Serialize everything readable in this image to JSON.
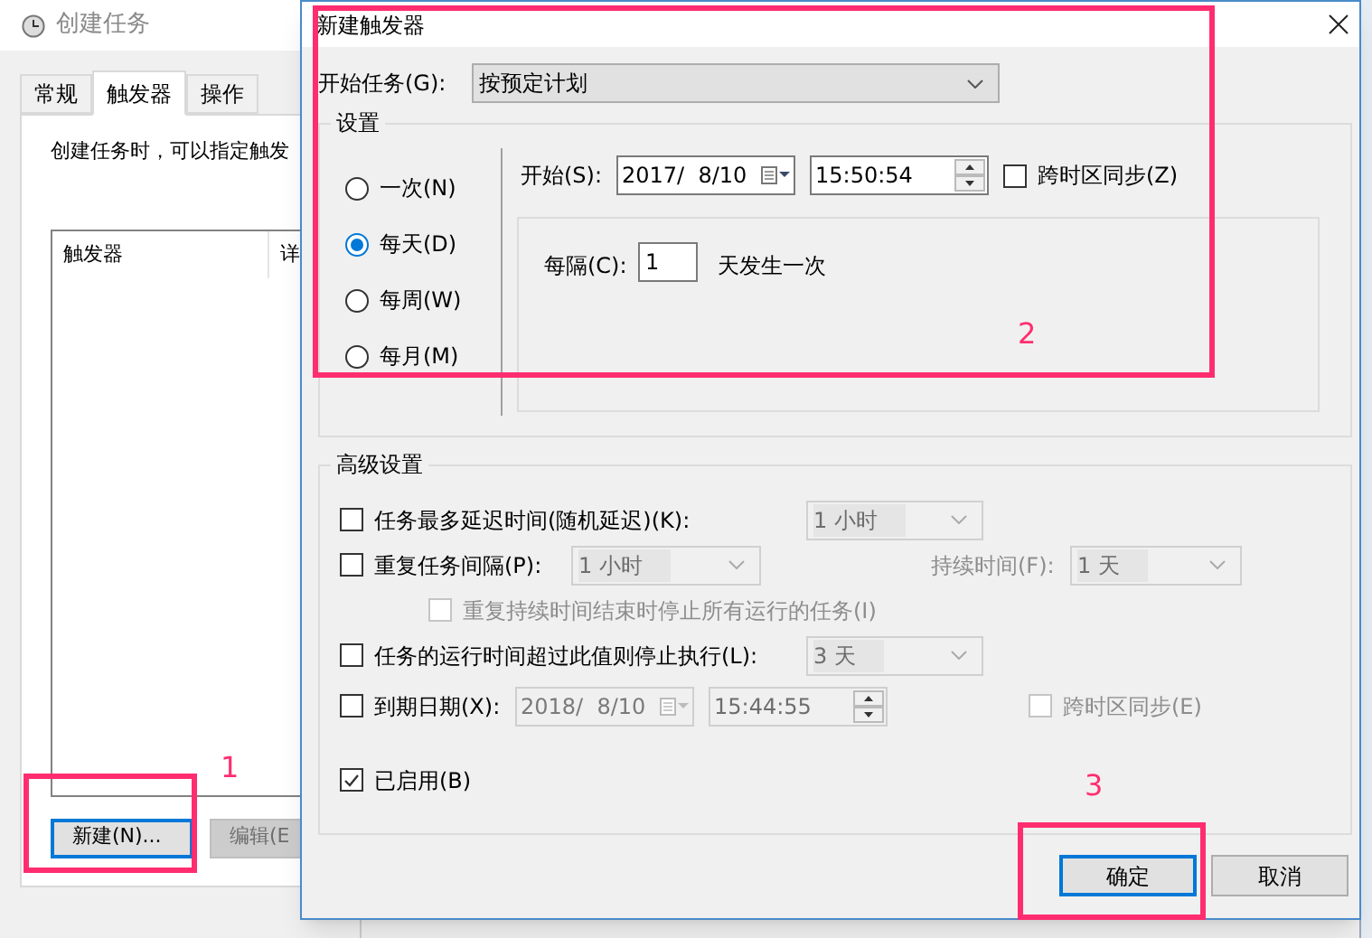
{
  "background_window": {
    "title": "创建任务",
    "tabs": [
      {
        "label": "常规",
        "selected": false
      },
      {
        "label": "触发器",
        "selected": true
      },
      {
        "label": "操作",
        "selected": false
      }
    ],
    "description": "创建任务时，可以指定触发",
    "list_columns": [
      "触发器",
      "详"
    ],
    "buttons": [
      {
        "label": "新建(N)...",
        "focused": true
      },
      {
        "label": "编辑(E",
        "focused": false
      }
    ]
  },
  "dialog": {
    "title": "新建触发器",
    "start_task": {
      "label": "开始任务(G):",
      "value": "按预定计划"
    },
    "settings": {
      "title": "设置",
      "schedules": [
        {
          "label": "一次(N)",
          "selected": false
        },
        {
          "label": "每天(D)",
          "selected": true
        },
        {
          "label": "每周(W)",
          "selected": false
        },
        {
          "label": "每月(M)",
          "selected": false
        }
      ],
      "start": {
        "label": "开始(S):",
        "date": "2017/  8/10",
        "time": "15:50:54"
      },
      "sync_timezone": {
        "label": "跨时区同步(Z)",
        "checked": false
      },
      "recur": {
        "label": "每隔(C):",
        "value": "1",
        "suffix": "天发生一次"
      }
    },
    "advanced": {
      "title": "高级设置",
      "delay": {
        "label": "任务最多延迟时间(随机延迟)(K):",
        "checked": false,
        "value": "1 小时",
        "disabled": true
      },
      "repeat": {
        "label": "重复任务间隔(P):",
        "checked": false,
        "value": "1 小时",
        "disabled": true,
        "duration_label": "持续时间(F):",
        "duration_value": "1 天"
      },
      "stop_at_end": {
        "label": "重复持续时间结束时停止所有运行的任务(I)",
        "checked": false,
        "disabled": true
      },
      "stop_if_longer": {
        "label": "任务的运行时间超过此值则停止执行(L):",
        "checked": false,
        "value": "3 天",
        "disabled": true
      },
      "expire": {
        "label": "到期日期(X):",
        "checked": false,
        "date": "2018/  8/10",
        "time": "15:44:55",
        "disabled": true,
        "sync_label": "跨时区同步(E)",
        "sync_checked": false
      },
      "enabled": {
        "label": "已启用(B)",
        "checked": true
      }
    },
    "buttons": [
      {
        "label": "确定",
        "focused": true
      },
      {
        "label": "取消",
        "focused": false
      }
    ]
  },
  "annotations": [
    {
      "label": "1"
    },
    {
      "label": "2"
    },
    {
      "label": "3"
    }
  ]
}
